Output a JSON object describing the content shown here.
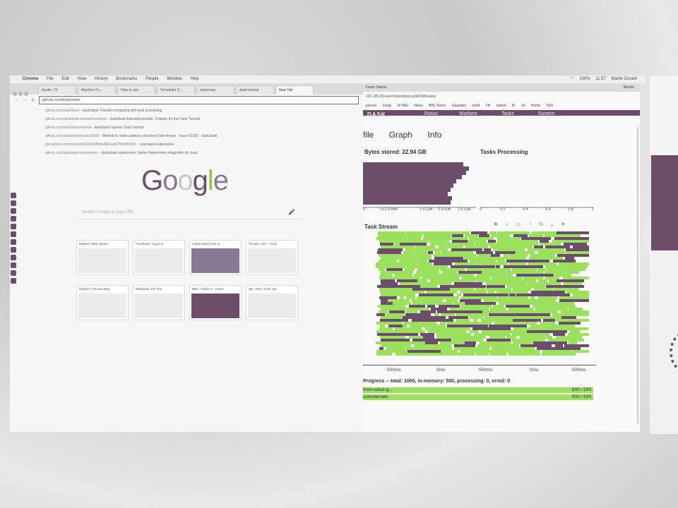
{
  "menubar": {
    "items": [
      "Chrome",
      "File",
      "Edit",
      "View",
      "History",
      "Bookmarks",
      "People",
      "Window",
      "Help"
    ],
    "battery": "100%",
    "clock": "11:57",
    "user": "Martin Durant"
  },
  "left_window": {
    "tabs": [
      "Austin, TX",
      "Machine Fo...",
      "How to use",
      "Scheduler D...",
      "superman",
      "dask-tutorial",
      "New Tab"
    ],
    "address": "github.com/dask/dask",
    "suggestions": [
      {
        "url": "github.com/dask/dask",
        "desc": " - dask/dask: Parallel computing with task scheduling"
      },
      {
        "url": "github.com/dask/dask-tutorial/tree/dask",
        "desc": " - dask/dask-tutorial/tree/dask: Chapter for the Dask Tutorial"
      },
      {
        "url": "github.com/dask/dask-tutorial",
        "desc": " - dask/dask-tutorial: Dask tutorial"
      },
      {
        "url": "github.com/dask/dask/issues/3182",
        "desc": " - Method to make arbitrary chunked Dask Arrays · Issue #3182 · dask/dask"
      },
      {
        "url": "gist.github.com/mrocklin/62d0d2ffd8a68b4a8d7b6b8b9b3c",
        "desc": " - user/dask-kubernetes"
      },
      {
        "url": "github.com/dask/dask-kubernetes",
        "desc": " - dask/dask-kubernetes: Native Kubernetes integration for dask"
      }
    ],
    "search_placeholder": "Search Google or type URL",
    "tiles": [
      {
        "title": "Newest 'dask' Quest"
      },
      {
        "title": "Facebook - log in or"
      },
      {
        "title": "Latest news from ar"
      },
      {
        "title": "Toronto, ON - 7 Day"
      },
      {
        "title": "blogTO | Toronto blog"
      },
      {
        "title": "Wikipedia, the free"
      },
      {
        "title": "BBC - Radio 4 - Home"
      },
      {
        "title": "XE: USD / CAD Cur"
      }
    ]
  },
  "right_window": {
    "tab_title": "Dask Status",
    "user": "Martin",
    "address": "226.189.29/user/mdurant/proxy/40288/status",
    "bookmarks": [
      "person",
      "comp",
      "W Wiki",
      "News",
      "BBC News",
      "Guardian",
      "nactl",
      "FB",
      "radio4",
      "W",
      "14",
      "Home",
      "F&S"
    ],
    "nav": [
      "DASK",
      "Status",
      "Workers",
      "Tasks",
      "System"
    ],
    "subnav": [
      "file",
      "Graph",
      "Info"
    ],
    "bytes_stored": "Bytes stored: 22.94 GB",
    "tasks_processing": "Tasks Processing",
    "memory_ticks": [
      "0",
      "512.0 MiB",
      "1.5 GiB",
      "2.0 GiB",
      "2.5 GiB"
    ],
    "proc_ticks": [
      "0",
      "0.2",
      "0.4",
      "0.6",
      "0.8",
      "1"
    ],
    "task_stream": "Task Stream",
    "ts_ticks": [
      "500ms",
      "0ms",
      "500ms",
      "0ms",
      "500ms"
    ],
    "progress_label": "Progress -- total: 1000, in-memory: 500, processing: 0, erred: 0",
    "progress_rows": [
      {
        "name": "from-value-g...",
        "value": "500 / 500"
      },
      {
        "name": "concatenate",
        "value": "500 / 500"
      }
    ]
  },
  "colors": {
    "dask_purple": "#6b4f6a",
    "task_green": "#9be15d"
  }
}
